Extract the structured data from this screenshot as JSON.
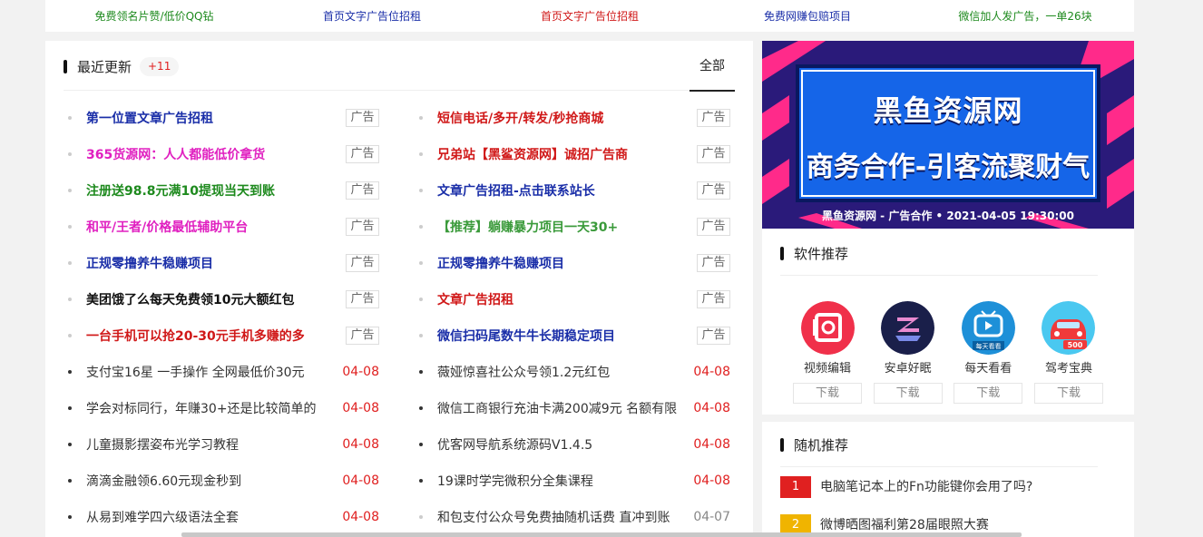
{
  "top_links": [
    {
      "text": "免费领名片赞/低价QQ钻",
      "color": "#1e8a1e"
    },
    {
      "text": "首页文字广告位招租",
      "color": "#1a2ea8"
    },
    {
      "text": "首页文字广告位招租",
      "color": "#d01818"
    },
    {
      "text": "免费网赚包赔项目",
      "color": "#1a2ea8"
    },
    {
      "text": "微信加人发广告，一单26块",
      "color": "#1e8a1e"
    }
  ],
  "recent": {
    "title": "最近更新",
    "badge": "+11",
    "tab_all": "全部",
    "rows": [
      [
        {
          "text": "第一位置文章广告招租",
          "color": "#1a2ea8",
          "ad": true,
          "tag": "广告"
        },
        {
          "text": "短信电话/多开/转发/秒抢商城",
          "color": "#d01818",
          "ad": true,
          "tag": "广告"
        }
      ],
      [
        {
          "text": "365货源网：人人都能低价拿货",
          "color": "#e020c0",
          "ad": true,
          "tag": "广告"
        },
        {
          "text": "兄弟站【黑鲨资源网】诚招广告商",
          "color": "#d01818",
          "ad": true,
          "tag": "广告"
        }
      ],
      [
        {
          "text": "注册送98.8元满10提现当天到账",
          "color": "#1e8a1e",
          "ad": true,
          "tag": "广告"
        },
        {
          "text": "文章广告招租-点击联系站长",
          "color": "#1a2ea8",
          "ad": true,
          "tag": "广告"
        }
      ],
      [
        {
          "text": "和平/王者/价格最低辅助平台",
          "color": "#e020c0",
          "ad": true,
          "tag": "广告"
        },
        {
          "text": "【推荐】躺赚暴力项目一天30+",
          "color": "#3a9a3a",
          "ad": true,
          "tag": "广告"
        }
      ],
      [
        {
          "text": "正规零撸养牛稳赚项目",
          "color": "#1a2ea8",
          "ad": true,
          "tag": "广告"
        },
        {
          "text": "正规零撸养牛稳赚项目",
          "color": "#1a2ea8",
          "ad": true,
          "tag": "广告"
        }
      ],
      [
        {
          "text": "美团饿了么每天免费领10元大额红包",
          "color": "#111111",
          "ad": true,
          "tag": "广告"
        },
        {
          "text": "文章广告招租",
          "color": "#d01818",
          "ad": true,
          "tag": "广告"
        }
      ],
      [
        {
          "text": "一台手机可以抢20-30元手机多赚的多",
          "color": "#d01818",
          "ad": true,
          "tag": "广告"
        },
        {
          "text": "微信扫码尾数牛牛长期稳定项目",
          "color": "#1a2ea8",
          "ad": true,
          "tag": "广告"
        }
      ],
      [
        {
          "text": "支付宝16星 一手操作 全网最低价30元",
          "color": "#333333",
          "ad": false,
          "date": "04-08"
        },
        {
          "text": "薇娅惊喜社公众号领1.2元红包",
          "color": "#333333",
          "ad": false,
          "date": "04-08"
        }
      ],
      [
        {
          "text": "学会对标同行，年赚30+还是比较简单的",
          "color": "#333333",
          "ad": false,
          "date": "04-08"
        },
        {
          "text": "微信工商银行充油卡满200减9元 名额有限",
          "color": "#333333",
          "ad": false,
          "date": "04-08"
        }
      ],
      [
        {
          "text": "儿童摄影摆姿布光学习教程",
          "color": "#333333",
          "ad": false,
          "date": "04-08"
        },
        {
          "text": "优客网导航系统源码V1.4.5",
          "color": "#333333",
          "ad": false,
          "date": "04-08"
        }
      ],
      [
        {
          "text": "滴滴金融领6.60元现金秒到",
          "color": "#333333",
          "ad": false,
          "date": "04-08"
        },
        {
          "text": "19课时学完微积分全集课程",
          "color": "#333333",
          "ad": false,
          "date": "04-08"
        }
      ],
      [
        {
          "text": "从易到难学四六级语法全套",
          "color": "#333333",
          "ad": false,
          "date": "04-08"
        },
        {
          "text": "和包支付公众号免费抽随机话费 直冲到账",
          "color": "#333333",
          "ad": false,
          "date": "04-07",
          "date_gray": true
        }
      ]
    ]
  },
  "banner": {
    "line1": "黑鱼资源网",
    "line2": "商务合作-引客流聚财气",
    "caption": "黑鱼资源网 - 广告合作 • 2021-04-05 19:30:00"
  },
  "software": {
    "title": "软件推荐",
    "apps": [
      {
        "name": "视频编辑",
        "download": "下载",
        "icon": "video-edit-icon"
      },
      {
        "name": "安卓好眠",
        "download": "下载",
        "icon": "sleep-app-icon"
      },
      {
        "name": "每天看看",
        "download": "下载",
        "icon": "tv-app-icon",
        "icon_text": "每天看看"
      },
      {
        "name": "驾考宝典",
        "download": "下载",
        "icon": "car-app-icon",
        "icon_text": "500"
      }
    ]
  },
  "random": {
    "title": "随机推荐",
    "items": [
      {
        "rank": "1",
        "text": "电脑笔记本上的Fn功能键你会用了吗?",
        "color": "#e02020"
      },
      {
        "rank": "2",
        "text": "微博晒图福利第28届眼照大赛",
        "color": "#f0b400"
      }
    ]
  }
}
